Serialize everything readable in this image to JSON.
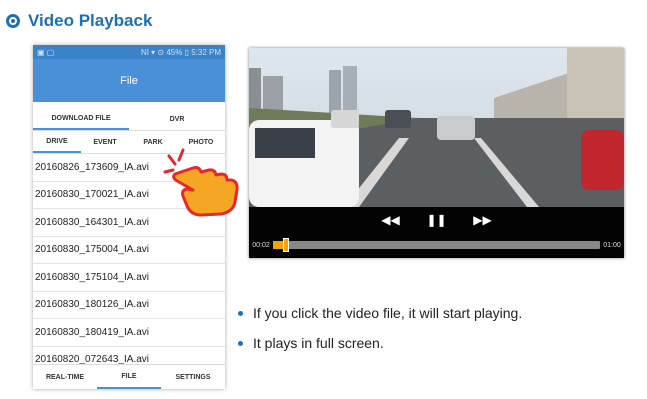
{
  "section": {
    "title": "Video Playback",
    "icon": "radio-target-icon"
  },
  "phone": {
    "status_time": "5:32 PM",
    "status_icons": "NI ▾ ⊙ 45% ▯",
    "app_title": "File",
    "subtabs": [
      {
        "label": "DOWNLOAD FILE",
        "active": true
      },
      {
        "label": "DVR",
        "active": false
      }
    ],
    "type_tabs": [
      {
        "label": "DRIVE",
        "active": true
      },
      {
        "label": "EVENT",
        "active": false
      },
      {
        "label": "PARK",
        "active": false
      },
      {
        "label": "PHOTO",
        "active": false
      }
    ],
    "files": [
      "20160826_173609_IA.avi",
      "20160830_170021_IA.avi",
      "20160830_164301_IA.avi",
      "20160830_175004_IA.avi",
      "20160830_175104_IA.avi",
      "20160830_180126_IA.avi",
      "20160830_180419_IA.avi",
      "20160820_072643_IA.avi"
    ],
    "bottom_nav": [
      {
        "label": "REAL-TIME",
        "active": false
      },
      {
        "label": "FILE",
        "active": true
      },
      {
        "label": "SETTINGS",
        "active": false
      }
    ]
  },
  "player": {
    "current_time": "00:02",
    "total_time": "01:00",
    "progress_fraction": 0.03,
    "buttons": [
      "rewind-icon",
      "pause-icon",
      "fast-forward-icon"
    ]
  },
  "bullets": [
    "If you click the video file, it will start playing.",
    "It plays in full screen."
  ],
  "colors": {
    "accent": "#1f6fb5",
    "appbar": "#4a90d9",
    "progress": "#f0a800",
    "hand": "#f5a623"
  }
}
